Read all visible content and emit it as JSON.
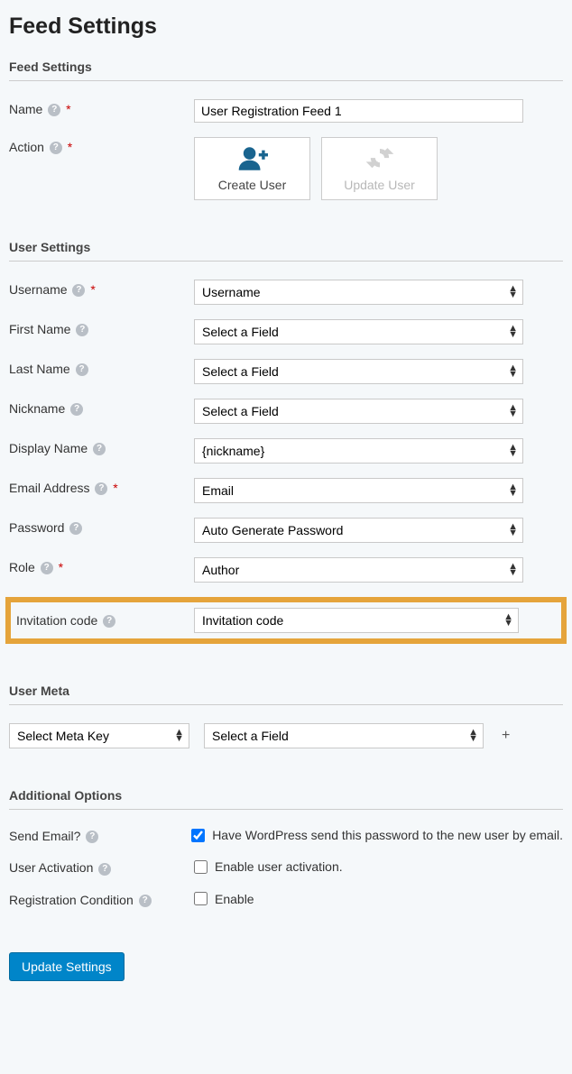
{
  "page_title": "Feed Settings",
  "sections": {
    "feed_settings": "Feed Settings",
    "user_settings": "User Settings",
    "user_meta": "User Meta",
    "additional_options": "Additional Options"
  },
  "fields": {
    "name": {
      "label": "Name",
      "value": "User Registration Feed 1",
      "required": true
    },
    "action": {
      "label": "Action",
      "required": true,
      "options": {
        "create_user": "Create User",
        "update_user": "Update User"
      },
      "selected": "create_user"
    },
    "username": {
      "label": "Username",
      "value": "Username",
      "required": true
    },
    "first_name": {
      "label": "First Name",
      "value": "Select a Field"
    },
    "last_name": {
      "label": "Last Name",
      "value": "Select a Field"
    },
    "nickname": {
      "label": "Nickname",
      "value": "Select a Field"
    },
    "display_name": {
      "label": "Display Name",
      "value": "{nickname}"
    },
    "email_address": {
      "label": "Email Address",
      "value": "Email",
      "required": true
    },
    "password": {
      "label": "Password",
      "value": "Auto Generate Password"
    },
    "role": {
      "label": "Role",
      "value": "Author",
      "required": true
    },
    "invitation_code": {
      "label": "Invitation code",
      "value": "Invitation code"
    },
    "meta_key": {
      "value": "Select Meta Key"
    },
    "meta_field": {
      "value": "Select a Field"
    },
    "send_email": {
      "label": "Send Email?",
      "text": "Have WordPress send this password to the new user by email.",
      "checked": true
    },
    "user_activation": {
      "label": "User Activation",
      "text": "Enable user activation.",
      "checked": false
    },
    "registration_condition": {
      "label": "Registration Condition",
      "text": "Enable",
      "checked": false
    }
  },
  "required_marker": "*",
  "submit_label": "Update Settings",
  "plus": "+"
}
